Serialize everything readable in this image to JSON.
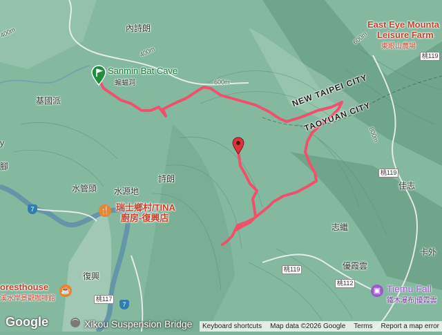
{
  "map": {
    "colors": {
      "terrain": "#7fb39a",
      "trail": "#f0506a",
      "river": "#5f8fa8",
      "road": "#e9eef0",
      "poi_red": "#c4442c",
      "poi_orange": "#e8852e",
      "poi_purple": "#9b59c9"
    },
    "labels": {
      "neishi": "內詩朗",
      "jiguopai": "基國派",
      "shuiguantou": "水管頭",
      "shuiyuandi": "水源地",
      "shilang": "詩朗",
      "zhijian": "志繼",
      "fuxing": "復興",
      "jiazhi": "佳志",
      "kawai": "卡外",
      "youxiayun": "優霞雲",
      "bat_cave_zh": "蝙蝠洞",
      "left_edge_a": "y",
      "left_edge_b": "腳",
      "elevation_400": "400m",
      "elevation_600": "600m",
      "elevation_800": "800m"
    },
    "pois": {
      "start": "Sanmin Bat Cave",
      "restaurant_line1": "瑞士鄉村/TINA",
      "restaurant_line2": "廚房-復興店",
      "forest_line1": "oresthouse",
      "forest_line2": "溪水岸景觀咖啡館",
      "east_eye_line1": "East Eye Mounta",
      "east_eye_line2": "Leisure Farm",
      "east_eye_line3": "東眼山農場",
      "tiemu_line1": "Tiemu Fall",
      "tiemu_line2": "鐵木瀑布|優霞雲",
      "bridge": "Xikou Suspension Bridge"
    },
    "cities": {
      "new_taipei": "NEW TAIPEI CITY",
      "taoyuan": "TAOYUAN CITY"
    },
    "roads": {
      "r7a": "7",
      "r7b": "7",
      "t119a": "桃119",
      "t119b": "桃119",
      "t119c": "桃119",
      "t117": "桃117",
      "t112": "桃112"
    },
    "icons": {
      "start_pin": "green-flag-pin",
      "end_pin": "red-marker-pin",
      "restaurant": "fork-knife-icon",
      "cafe": "coffee-cup-icon",
      "waterfall": "photo-icon",
      "bridge": "bridge-icon"
    }
  },
  "footer": {
    "logo": "Google",
    "keyboard": "Keyboard shortcuts",
    "mapdata": "Map data ©2026 Google",
    "terms": "Terms",
    "report": "Report a map error"
  }
}
